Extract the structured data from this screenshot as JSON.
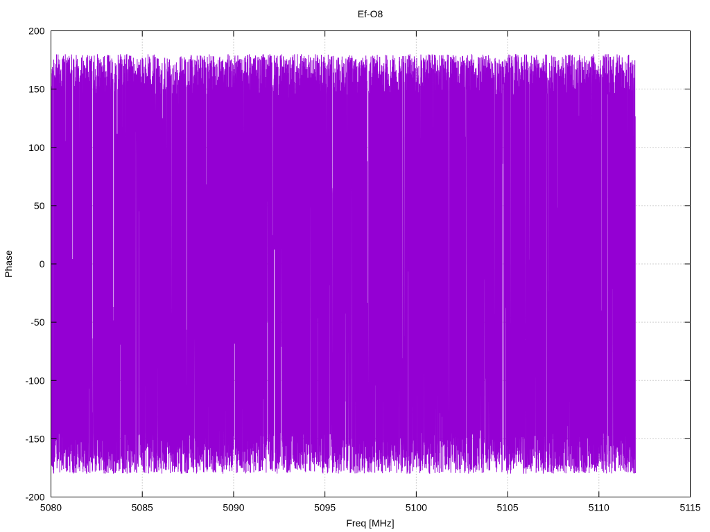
{
  "chart_data": {
    "type": "line",
    "title": "Ef-O8",
    "xlabel": "Freq [MHz]",
    "ylabel": "Phase",
    "xlim": [
      5080,
      5115
    ],
    "ylim": [
      -200,
      200
    ],
    "xticks": [
      5080,
      5085,
      5090,
      5095,
      5100,
      5105,
      5110,
      5115
    ],
    "yticks": [
      -200,
      -150,
      -100,
      -50,
      0,
      50,
      100,
      150,
      200
    ],
    "grid": true,
    "legend": "none",
    "series": [
      {
        "color": "#9400d3",
        "description_values": "dense phase-wrapped trace oscillating between about -180 and 180 over the whole band",
        "x_range": [
          5080,
          5112
        ],
        "y_range": [
          -180,
          180
        ],
        "samples": 6400
      }
    ]
  }
}
